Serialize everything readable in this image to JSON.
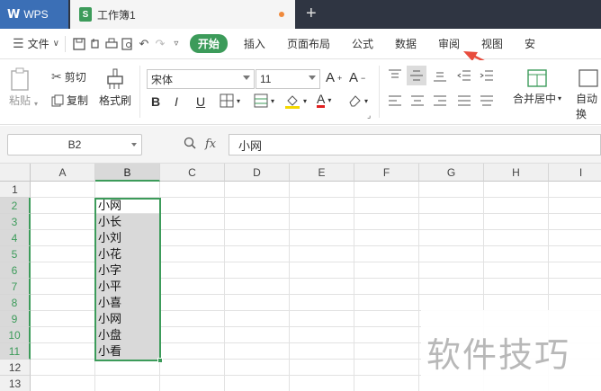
{
  "titlebar": {
    "app_label": "WPS",
    "doc_title": "工作簿1",
    "new_tab": "+"
  },
  "menubar": {
    "file_label": "文件",
    "tabs": [
      "开始",
      "插入",
      "页面布局",
      "公式",
      "数据",
      "审阅",
      "视图",
      "安"
    ]
  },
  "ribbon": {
    "paste": "粘贴",
    "cut": "剪切",
    "copy": "复制",
    "format_painter": "格式刷",
    "font_name": "宋体",
    "font_size": "11",
    "merge_center": "合并居中",
    "auto_wrap": "自动换"
  },
  "formula_bar": {
    "name_box": "B2",
    "fx": "fx",
    "value": "小网"
  },
  "grid": {
    "columns": [
      "A",
      "B",
      "C",
      "D",
      "E",
      "F",
      "G",
      "H",
      "I"
    ],
    "rows": [
      "1",
      "2",
      "3",
      "4",
      "5",
      "6",
      "7",
      "8",
      "9",
      "10",
      "11",
      "12",
      "13"
    ],
    "column_b_values": [
      "小网",
      "小长",
      "小刘",
      "小花",
      "小字",
      "小平",
      "小喜",
      "小网",
      "小盘",
      "小看"
    ]
  },
  "watermark": "软件技巧",
  "colors": {
    "accent": "#3c9b5a",
    "arrow": "#e84c3d",
    "titlebar": "#2f3542"
  }
}
